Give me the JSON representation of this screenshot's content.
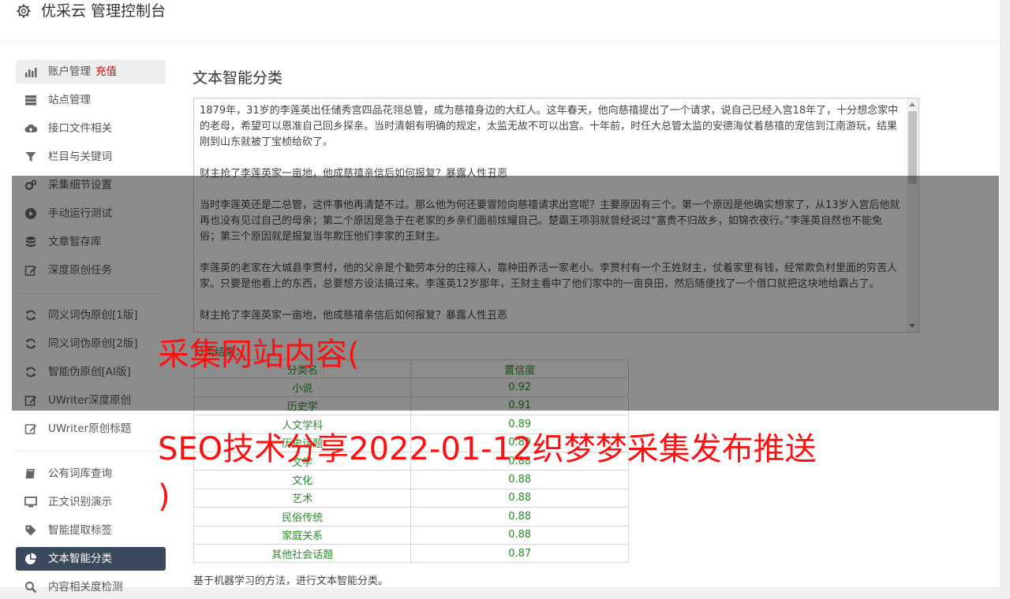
{
  "app": {
    "title": "优采云 管理控制台"
  },
  "sidebar": {
    "items": [
      {
        "label": "账户管理",
        "badge": "充值",
        "icon": "bar-chart-icon"
      },
      {
        "label": "站点管理",
        "icon": "server-icon"
      },
      {
        "label": "接口文件相关",
        "icon": "cloud-upload-icon"
      },
      {
        "label": "栏目与关键词",
        "icon": "filter-icon"
      },
      {
        "label": "采集细节设置",
        "icon": "gears-icon"
      },
      {
        "label": "手动运行测试",
        "icon": "play-circle-icon"
      },
      {
        "label": "文章暂存库",
        "icon": "database-icon"
      },
      {
        "label": "深度原创任务",
        "icon": "edit-icon"
      },
      {
        "label": "同义词伪原创[1版]",
        "icon": "refresh-icon"
      },
      {
        "label": "同义词伪原创[2版]",
        "icon": "refresh-icon"
      },
      {
        "label": "智能伪原创[AI版]",
        "icon": "refresh-icon"
      },
      {
        "label": "UWriter深度原创",
        "icon": "edit-icon"
      },
      {
        "label": "UWriter原创标题",
        "icon": "edit-icon"
      },
      {
        "label": "公有词库查询",
        "icon": "book-icon"
      },
      {
        "label": "正文识别演示",
        "icon": "desktop-icon"
      },
      {
        "label": "智能提取标签",
        "icon": "tag-icon"
      },
      {
        "label": "文本智能分类",
        "icon": "pie-chart-icon"
      },
      {
        "label": "内容相关度检测",
        "icon": "search-icon"
      }
    ]
  },
  "main": {
    "title": "文本智能分类",
    "text_paragraphs": [
      "1879年，31岁的李莲英出任储秀宫四品花翎总管，成为慈禧身边的大红人。这年春天，他向慈禧提出了一个请求，说自己已经入宫18年了，十分想念家中的老母，希望可以恩准自己回乡探亲。当时清朝有明确的规定，太监无故不可以出宫。十年前，时任大总管太监的安德海仗着慈禧的宠信到江南游玩，结果刚到山东就被丁宝桢给砍了。",
      "财主抢了李莲英家一亩地，他成慈禧亲信后如何报复？暴露人性丑恶",
      "当时李莲英还是二总管，这件事他再清楚不过。那么他为何还要冒险向慈禧请求出宫呢？主要原因有三个。第一个原因是他确实想家了，从13岁入宫后他就再也没有见过自己的母亲；第二个原因是急于在老家的乡亲们面前炫耀自己。楚霸王项羽就曾经说过“富贵不归故乡，如锦衣夜行。”李莲英自然也不能免俗；第三个原因就是报复当年欺压他们李家的王财主。",
      "李莲英的老家在大城县李贾村，他的父亲是个勤劳本分的庄稼人，靠种田养活一家老小。李贾村有一个王姓财主，仗着家里有钱，经常欺负村里面的穷苦人家。只要是他看上的东西，总要想方设法搞过来。李莲英12岁那年，王财主看中了他们家中的一亩良田，然后随便找了一个借口就把这块地给霸占了。",
      "财主抢了李莲英家一亩地，他成慈禧亲信后如何报复？暴露人性丑恶"
    ],
    "result_caption": "分类结果：",
    "table": {
      "headers": [
        "分类名",
        "置信度"
      ],
      "rows": [
        [
          "小说",
          "0.92"
        ],
        [
          "历史学",
          "0.91"
        ],
        [
          "人文学科",
          "0.89"
        ],
        [
          "历史话题",
          "0.89"
        ],
        [
          "文学",
          "0.88"
        ],
        [
          "文化",
          "0.88"
        ],
        [
          "艺术",
          "0.88"
        ],
        [
          "民俗传统",
          "0.88"
        ],
        [
          "家庭关系",
          "0.88"
        ],
        [
          "其他社会话题",
          "0.87"
        ]
      ]
    },
    "footnote": "基于机器学习的方法，进行文本智能分类。"
  },
  "overlay": {
    "line1": "采集网站内容(",
    "line2": "SEO技术分享2022-01-12织梦梦采集发布推送",
    "line3": ")"
  },
  "colors": {
    "active_nav": "#3a4a5c",
    "badge": "#e00000",
    "table_text": "#2a8a2a",
    "overlay_text": "#ff1010"
  }
}
